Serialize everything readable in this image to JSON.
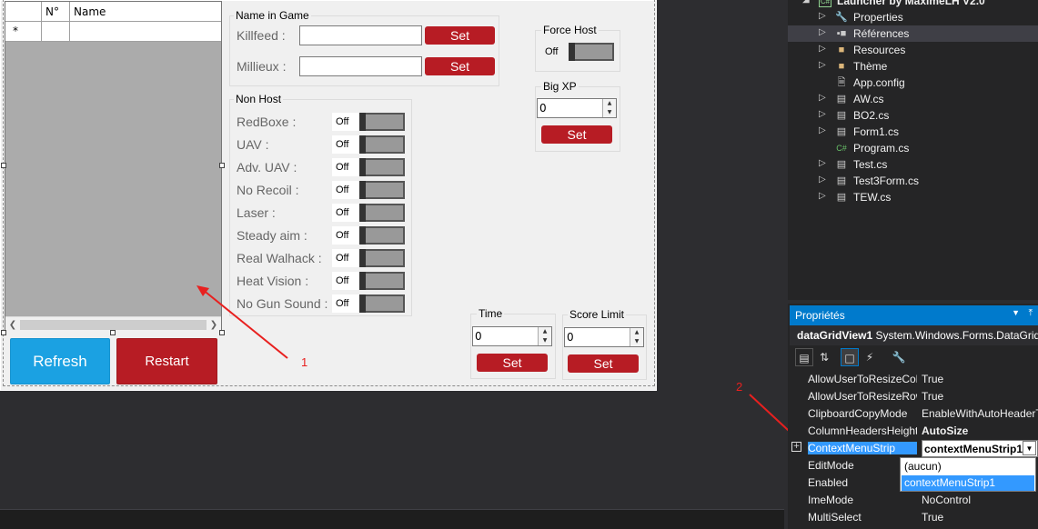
{
  "grid": {
    "col_num": "N°",
    "col_name": "Name",
    "new_row_marker": "*"
  },
  "buttons": {
    "refresh": "Refresh",
    "restart": "Restart"
  },
  "name_in_game": {
    "title": "Name in Game",
    "killfeed": "Killfeed :",
    "millieux": "Millieux :",
    "set": "Set"
  },
  "force_host": {
    "title": "Force Host",
    "state": "Off"
  },
  "big_xp": {
    "title": "Big XP",
    "value": "0",
    "set": "Set"
  },
  "non_host": {
    "title": "Non Host",
    "items": [
      {
        "label": "RedBoxe :",
        "state": "Off"
      },
      {
        "label": "UAV :",
        "state": "Off"
      },
      {
        "label": "Adv. UAV :",
        "state": "Off"
      },
      {
        "label": "No Recoil :",
        "state": "Off"
      },
      {
        "label": "Laser :",
        "state": "Off"
      },
      {
        "label": "Steady aim :",
        "state": "Off"
      },
      {
        "label": "Real Walhack :",
        "state": "Off"
      },
      {
        "label": "Heat Vision :",
        "state": "Off"
      },
      {
        "label": "No Gun Sound :",
        "state": "Off"
      }
    ]
  },
  "time": {
    "title": "Time",
    "value": "0",
    "set": "Set"
  },
  "score_limit": {
    "title": "Score Limit",
    "value": "0",
    "set": "Set"
  },
  "annotations": {
    "one": "1",
    "two": "2"
  },
  "solution_explorer": {
    "project": "Launcher by MaximeLH V2.0",
    "items": [
      {
        "label": "Properties",
        "icon": "wrench-icon"
      },
      {
        "label": "Références",
        "icon": "references-icon"
      },
      {
        "label": "Resources",
        "icon": "folder-icon"
      },
      {
        "label": "Thème",
        "icon": "folder-icon"
      },
      {
        "label": "App.config",
        "icon": "config-file-icon"
      },
      {
        "label": "AW.cs",
        "icon": "form-icon"
      },
      {
        "label": "BO2.cs",
        "icon": "form-icon"
      },
      {
        "label": "Form1.cs",
        "icon": "form-icon"
      },
      {
        "label": "Program.cs",
        "icon": "csharp-icon"
      },
      {
        "label": "Test.cs",
        "icon": "form-icon"
      },
      {
        "label": "Test3Form.cs",
        "icon": "form-icon"
      },
      {
        "label": "TEW.cs",
        "icon": "form-icon"
      }
    ]
  },
  "properties": {
    "title": "Propriétés",
    "object_name": "dataGridView1",
    "object_type": "System.Windows.Forms.DataGridView",
    "rows": [
      {
        "name": "AllowUserToResizeColumns",
        "value": "True"
      },
      {
        "name": "AllowUserToResizeRows",
        "value": "True"
      },
      {
        "name": "ClipboardCopyMode",
        "value": "EnableWithAutoHeaderText"
      },
      {
        "name": "ColumnHeadersHeightSizeMode",
        "value": "AutoSize"
      },
      {
        "name": "ContextMenuStrip",
        "value": "contextMenuStrip1"
      },
      {
        "name": "EditMode",
        "value": ""
      },
      {
        "name": "Enabled",
        "value": ""
      },
      {
        "name": "ImeMode",
        "value": "NoControl"
      },
      {
        "name": "MultiSelect",
        "value": "True"
      }
    ],
    "dropdown_options": [
      "(aucun)",
      "contextMenuStrip1"
    ]
  }
}
